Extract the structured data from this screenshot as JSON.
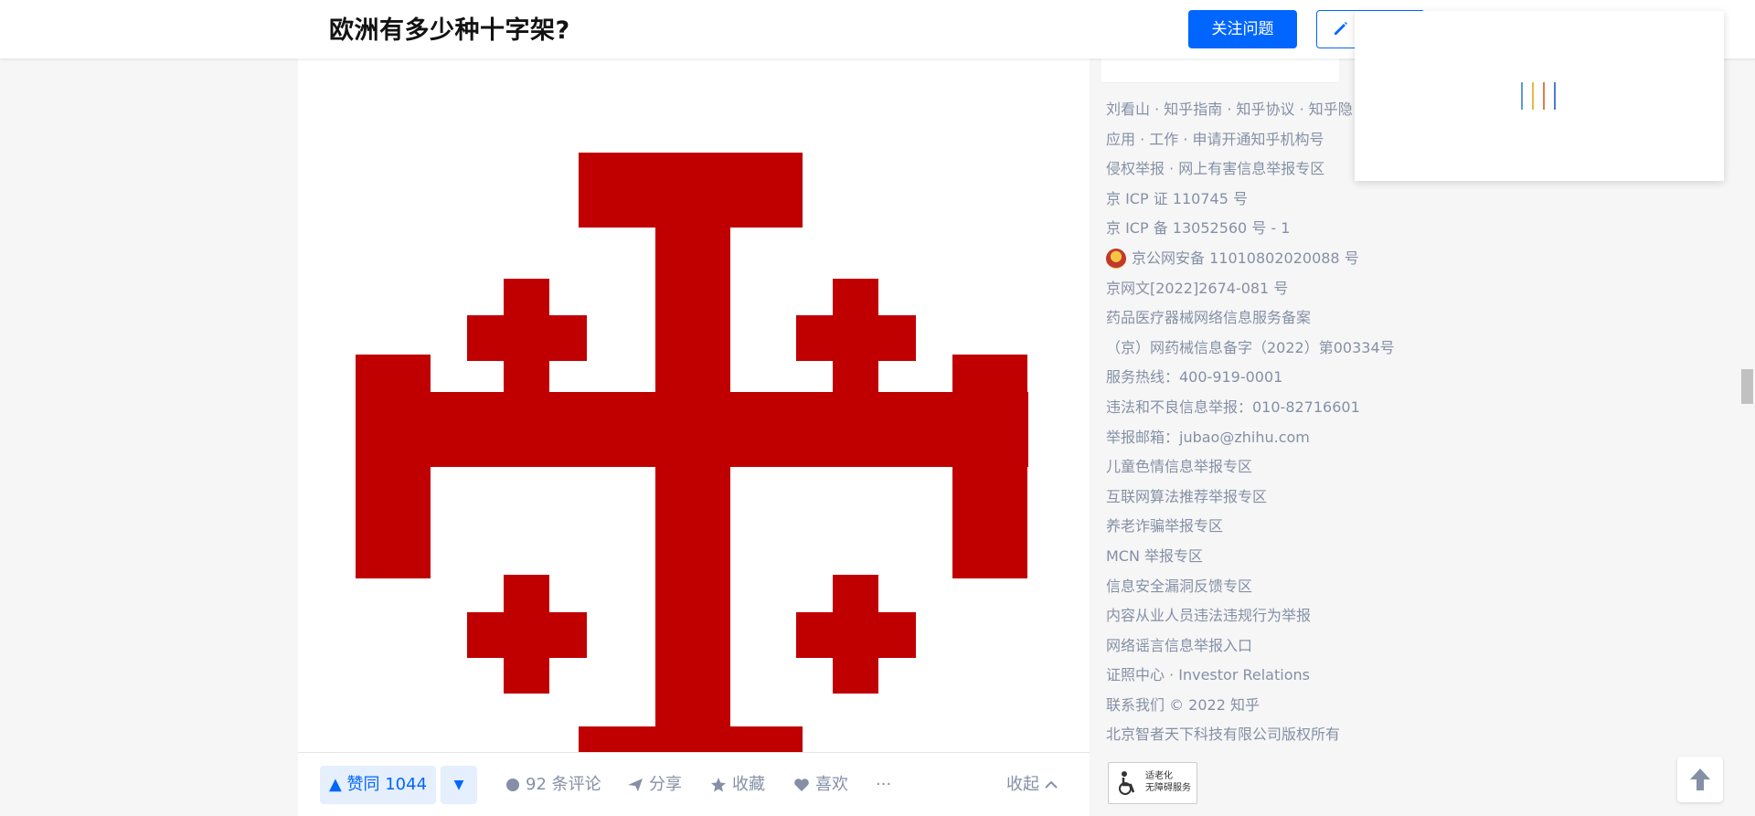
{
  "header": {
    "question_title": "欧洲有多少种十字架?",
    "follow_button": "关注问题",
    "write_answer_icon": "pencil-icon"
  },
  "answer": {
    "image_description_icon": "jerusalem-cross",
    "cross_color": "#c00000"
  },
  "actions": {
    "upvote": "▲ 赞同 1044",
    "downvote": "▼",
    "comments": "92 条评论",
    "share": "分享",
    "favorite": "收藏",
    "like": "喜欢",
    "more": "···",
    "collapse": "收起"
  },
  "footer": {
    "links": [
      "刘看山 · 知乎指南 · 知乎协议 · 知乎隐",
      "应用 · 工作 · 申请开通知乎机构号",
      "侵权举报 · 网上有害信息举报专区",
      "京 ICP 证 110745 号",
      "京 ICP 备 13052560 号 - 1",
      "京公网安备 11010802020088 号",
      "京网文[2022]2674-081 号",
      "药品医疗器械网络信息服务备案",
      "（京）网药械信息备字（2022）第00334号",
      "服务热线：400-919-0001",
      "违法和不良信息举报：010-82716601",
      "举报邮箱：jubao@zhihu.com",
      "儿童色情信息举报专区",
      "互联网算法推荐举报专区",
      "养老诈骗举报专区",
      "MCN 举报专区",
      "信息安全漏洞反馈专区",
      "内容从业人员违法违规行为举报",
      "网络谣言信息举报入口",
      "证照中心 · Investor Relations",
      "联系我们 © 2022 知乎",
      "北京智者天下科技有限公司版权所有"
    ],
    "elder_badge_line1": "适老化",
    "elder_badge_line2": "无障碍服务"
  },
  "colors": {
    "brand_blue": "#0066ff",
    "muted_text": "#8590a6"
  }
}
